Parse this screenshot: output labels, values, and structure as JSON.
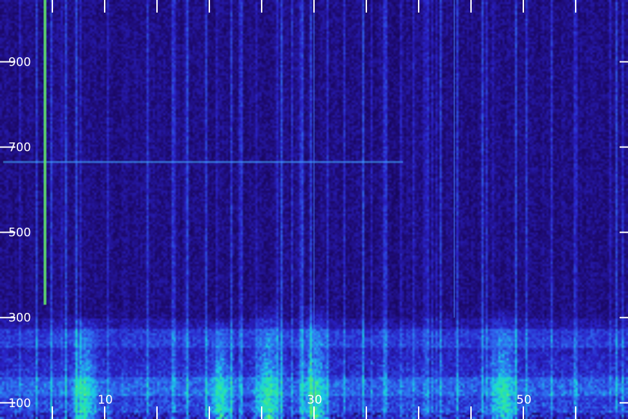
{
  "chart_data": {
    "type": "heatmap",
    "title": "",
    "xlabel": "",
    "ylabel": "",
    "x_ticks": [
      {
        "value": 10,
        "label": "10"
      },
      {
        "value": 30,
        "label": "30"
      },
      {
        "value": 50,
        "label": "50"
      }
    ],
    "y_ticks": [
      {
        "value": 100,
        "label": "100"
      },
      {
        "value": 300,
        "label": "300"
      },
      {
        "value": 500,
        "label": "500"
      },
      {
        "value": 700,
        "label": "700"
      },
      {
        "value": 900,
        "label": "900"
      }
    ],
    "x_range": [
      0,
      60
    ],
    "y_range": [
      62,
      1045
    ],
    "grid": false,
    "legend": "none",
    "colormap": [
      "#0b0030",
      "#1d0a6e",
      "#2a22c8",
      "#2f6cf0",
      "#19d0e6",
      "#2ee89a",
      "#7cf05a"
    ],
    "features": [
      {
        "kind": "horizontal-line",
        "y": 665,
        "x_start": 0.3,
        "x_end": 38.5,
        "intensity": 0.55
      },
      {
        "kind": "vertical-line",
        "x": 4.3,
        "y_start": 330,
        "y_end": 1045,
        "intensity": 0.9
      },
      {
        "kind": "vertical-line",
        "x": 30.0,
        "y_start": 62,
        "y_end": 1045,
        "intensity": 0.45
      },
      {
        "kind": "vertical-line",
        "x": 43.4,
        "y_start": 300,
        "y_end": 1045,
        "intensity": 0.5
      },
      {
        "kind": "low-band",
        "y_start": 62,
        "y_end": 300,
        "intensity": 0.6
      },
      {
        "kind": "hot-column",
        "x": 25.5,
        "y_start": 62,
        "y_end": 330,
        "intensity": 0.85
      },
      {
        "kind": "hot-column",
        "x": 30.0,
        "y_start": 62,
        "y_end": 330,
        "intensity": 0.8
      },
      {
        "kind": "hot-column",
        "x": 48.0,
        "y_start": 62,
        "y_end": 320,
        "intensity": 0.8
      },
      {
        "kind": "hot-column",
        "x": 8.0,
        "y_start": 62,
        "y_end": 300,
        "intensity": 0.75
      },
      {
        "kind": "hot-column",
        "x": 21.0,
        "y_start": 62,
        "y_end": 290,
        "intensity": 0.7
      }
    ]
  }
}
